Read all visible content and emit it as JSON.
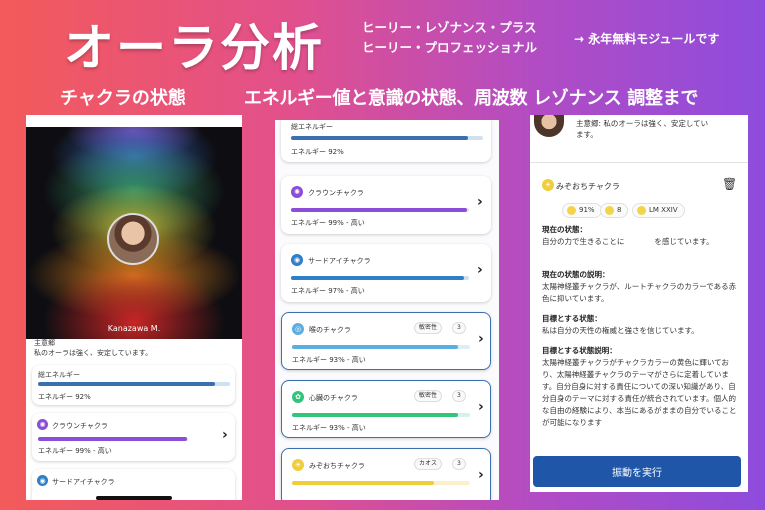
{
  "header": {
    "title": "オーラ分析",
    "products": [
      "ヒーリー・レゾナンス・プラス",
      "ヒーリー・プロフェッショナル"
    ],
    "free_note": "→ 永年無料モジュールです",
    "subtitle_left": "チャクラの状態",
    "subtitle_right": "エネルギー値と意識の状態、周波数 レゾナンス 調整まで"
  },
  "phone1": {
    "user_name": "Kanazawa M.",
    "main_label": "主意郷",
    "main_text": "私のオーラは強く、安定しています。",
    "total": {
      "label": "総エネルギー",
      "energy": "エネルギー 92%",
      "value": 92
    },
    "crown": {
      "label": "クラウンチャクラ",
      "energy": "エネルギー 99% - 高い",
      "value": 99
    },
    "third_eye": {
      "label": "サードアイチャクラ"
    }
  },
  "phone2": {
    "total": {
      "label": "総エネルギー",
      "energy": "エネルギー 92%",
      "value": 92
    },
    "chakras": [
      {
        "label": "クラウンチャクラ",
        "energy": "エネルギー 99% - 高い",
        "value": 99,
        "color": "#8a4fd6"
      },
      {
        "label": "サードアイチャクラ",
        "energy": "エネルギー 97% - 高い",
        "value": 97,
        "color": "#2f7ec8"
      },
      {
        "label": "喉のチャクラ",
        "energy": "エネルギー 93% - 高い",
        "value": 93,
        "color": "#5aaee0",
        "badge": "敏密性",
        "count": "3"
      },
      {
        "label": "心臓のチャクラ",
        "energy": "エネルギー 93% - 高い",
        "value": 93,
        "color": "#34c37a",
        "badge": "敏密性",
        "count": "3"
      },
      {
        "label": "みぞおちチャクラ",
        "energy": "",
        "value": 80,
        "color": "#f0cd3a",
        "badge": "カオス",
        "count": "3"
      }
    ]
  },
  "phone3": {
    "main_text_1": "主意郷: 私のオーラは強く、安定してい",
    "main_text_2": "ます。",
    "chakra_title": "みぞおちチャクラ",
    "stats": [
      "91%",
      "8",
      "LM XXIV"
    ],
    "current_state_label": "現在の状態：",
    "current_state_text": "自分の力で生きることに　　　　を感じています。",
    "current_desc_label": "現在の状態の説明：",
    "current_desc_text": "太陽神経叢チャクラが、ルートチャクラのカラーである赤色に抑いています。",
    "goal_label": "目標とする状態：",
    "goal_text": "私は自分の天性の権威と強さを信じています。",
    "goal_desc_label": "目標とする状態説明：",
    "goal_desc_text": "太陽神経叢チャクラがチャクラカラーの黄色に輝いており、太陽神経叢チャクラのテーマがさらに定着しています。自分自身に対する責任についての深い知識があり、自分自身のテーマに対する責任が統合されています。個人的な自由の経験により、本当にあるがままの自分でいることが可能になります",
    "run_button": "振動を実行"
  }
}
